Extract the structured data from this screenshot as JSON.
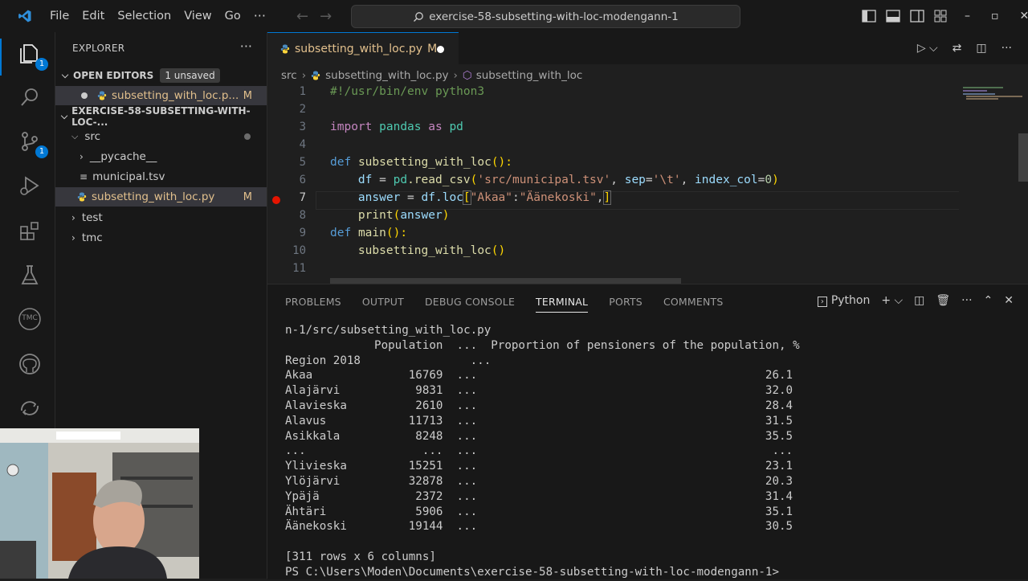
{
  "titlebar": {
    "menu": [
      "File",
      "Edit",
      "Selection",
      "View",
      "Go"
    ],
    "more": "···",
    "search": "exercise-58-subsetting-with-loc-modengann-1"
  },
  "activity": {
    "explorer_badge": "1",
    "scm_badge": "1",
    "tmc_label": "TMC"
  },
  "sidebar": {
    "title": "EXPLORER",
    "more": "···",
    "open_editors": {
      "label": "OPEN EDITORS",
      "badge": "1 unsaved",
      "items": [
        {
          "name": "subsetting_with_loc.p...",
          "status": "M"
        }
      ]
    },
    "workspace": {
      "label": "EXERCISE-58-SUBSETTING-WITH-LOC-...",
      "tree": [
        {
          "name": "src",
          "kind": "folder-open"
        },
        {
          "name": "__pycache__",
          "kind": "folder"
        },
        {
          "name": "municipal.tsv",
          "kind": "file"
        },
        {
          "name": "subsetting_with_loc.py",
          "kind": "py",
          "status": "M"
        },
        {
          "name": "test",
          "kind": "folder"
        },
        {
          "name": "tmc",
          "kind": "folder"
        }
      ]
    }
  },
  "editor": {
    "tab": {
      "name": "subsetting_with_loc.py",
      "status": "M"
    },
    "breadcrumb": [
      "src",
      "subsetting_with_loc.py",
      "subsetting_with_loc"
    ],
    "line_numbers": [
      "1",
      "2",
      "3",
      "4",
      "5",
      "6",
      "7",
      "8",
      "9",
      "10",
      "11"
    ],
    "code": {
      "l1": "#!/usr/bin/env python3",
      "l3_kw": "import",
      "l3_mod": "pandas",
      "l3_as": "as",
      "l3_alias": "pd",
      "l5_def": "def",
      "l5_fn": "subsetting_with_loc",
      "l5_rest": "():",
      "l6_var": "df",
      "l6_eq": " = ",
      "l6_pd": "pd",
      "l6_fn": ".read_csv",
      "l6_str": "'src/municipal.tsv'",
      "l6_sep": "sep",
      "l6_sepval": "'\\t'",
      "l6_idx": "index_col",
      "l6_num": "0",
      "l7_var": "answer",
      "l7_eq": " = ",
      "l7_df": "df",
      "l7_loc": ".loc",
      "l7_s1": "\"Akaa\"",
      "l7_colon": ":",
      "l7_s2": "\"Äänekoski\"",
      "l7_tail": ",",
      "l8_fn": "print",
      "l8_arg": "answer",
      "l9_def": "def",
      "l9_fn": "main",
      "l9_rest": "():",
      "l10_fn": "subsetting_with_loc",
      "l10_rest": "()"
    }
  },
  "panel": {
    "tabs": [
      "PROBLEMS",
      "OUTPUT",
      "DEBUG CONSOLE",
      "TERMINAL",
      "PORTS",
      "COMMENTS"
    ],
    "active_tab": "TERMINAL",
    "shell": "Python",
    "terminal_lines": [
      "n-1/src/subsetting_with_loc.py",
      "             Population  ...  Proportion of pensioners of the population, %",
      "Region 2018                ...",
      "Akaa              16769  ...                                          26.1",
      "Alajärvi           9831  ...                                          32.0",
      "Alavieska          2610  ...                                          28.4",
      "Alavus            11713  ...                                          31.5",
      "Asikkala           8248  ...                                          35.5",
      "...                 ...  ...                                           ...",
      "Ylivieska         15251  ...                                          23.1",
      "Ylöjärvi          32878  ...                                          20.3",
      "Ypäjä              2372  ...                                          31.4",
      "Ähtäri             5906  ...                                          35.1",
      "Äänekoski         19144  ...                                          30.5",
      "",
      "[311 rows x 6 columns]",
      "PS C:\\Users\\Moden\\Documents\\exercise-58-subsetting-with-loc-modengann-1>"
    ]
  },
  "colors": {
    "accent": "#0078d4",
    "modified": "#e2c08d",
    "breakpoint": "#e51400"
  }
}
